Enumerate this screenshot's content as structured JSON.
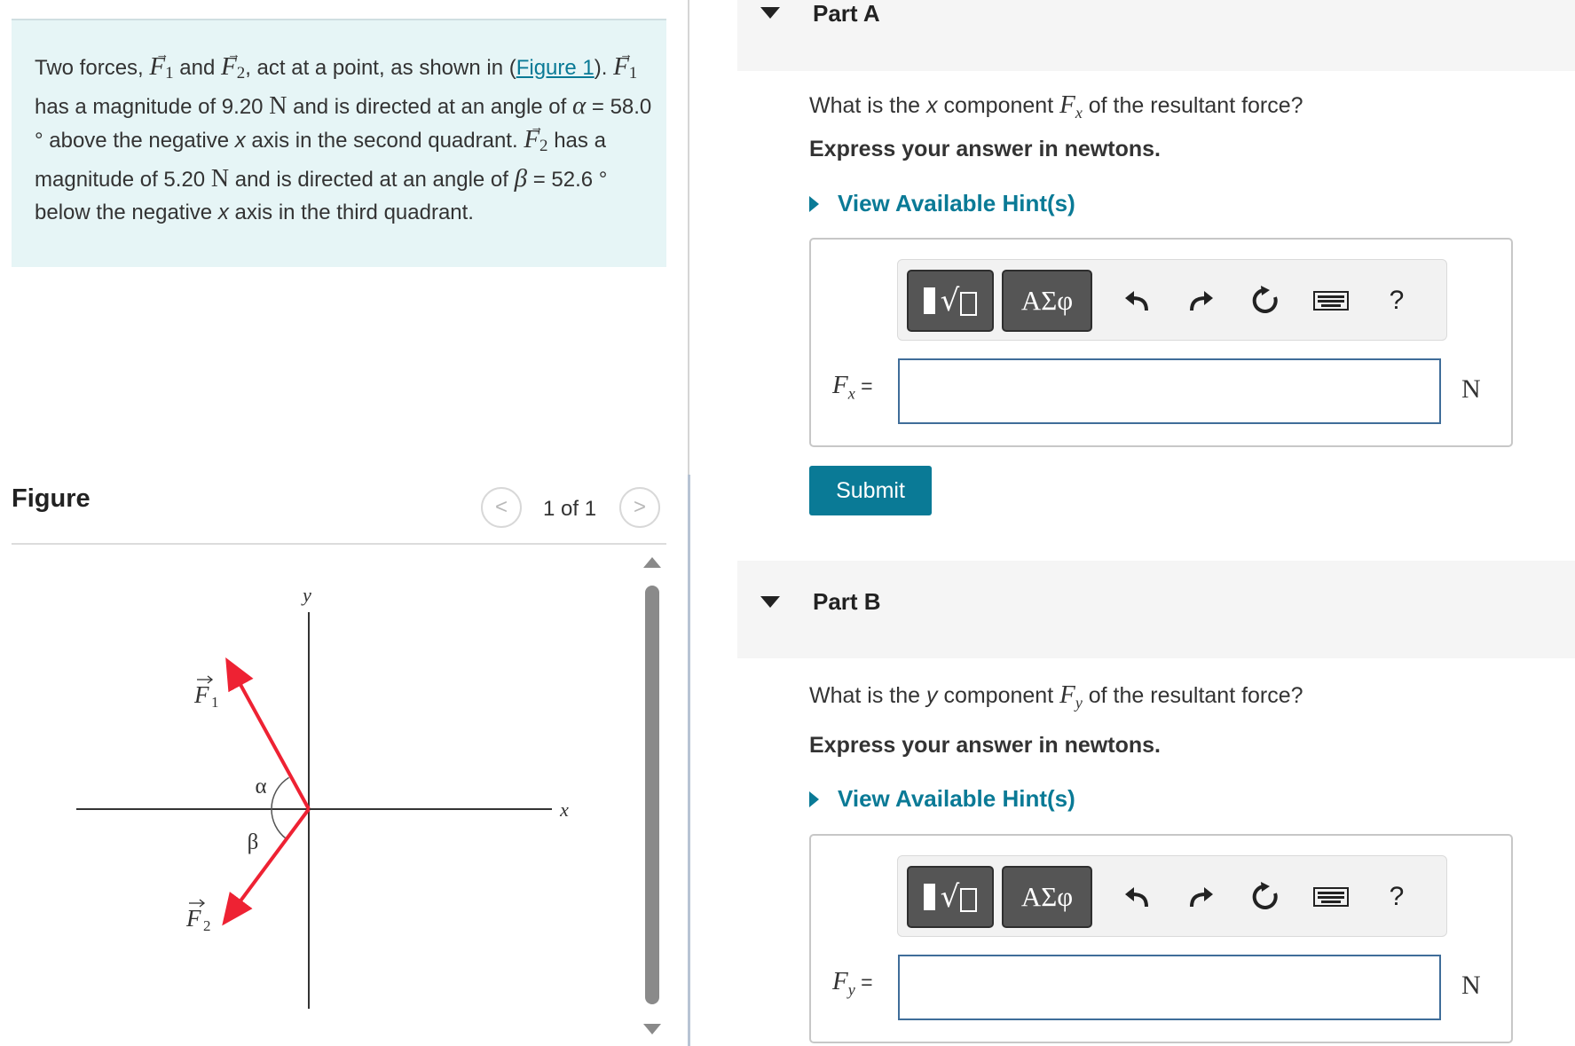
{
  "problem": {
    "t1": "Two forces, ",
    "f1": "F",
    "sub1": "1",
    "t2": " and ",
    "f2": "F",
    "sub2": "2",
    "t3": ", act at a point, as shown in (",
    "figure_link": "Figure 1",
    "t4": "). ",
    "f1b": "F",
    "sub1b": "1",
    "t5": " has a magnitude of 9.20 ",
    "unit1": "N",
    "t6": " and is directed at an angle of ",
    "alpha": "α",
    "t7": " = 58.0 ° above the negative ",
    "x1": "x",
    "t8": " axis in the second quadrant. ",
    "f2b": "F",
    "sub2b": "2",
    "t9": " has a magnitude of 5.20 ",
    "unit2": "N",
    "t10": " and is directed at an angle of ",
    "beta": "β",
    "t11": " = 52.6 ° below the negative ",
    "x2": "x",
    "t12": " axis in the third quadrant."
  },
  "figure_panel": {
    "title": "Figure",
    "counter": "1 of 1",
    "prev_glyph": "<",
    "next_glyph": ">",
    "diagram": {
      "y_label": "y",
      "x_label": "x",
      "f1_label": "F",
      "f1_sub": "1",
      "f2_label": "F",
      "f2_sub": "2",
      "alpha_label": "α",
      "beta_label": "β"
    }
  },
  "toolbar": {
    "templates_glyph": "√",
    "greek_label": "ΑΣφ",
    "help_label": "?"
  },
  "part_a": {
    "title": "Part A",
    "q1": "What is the ",
    "axis": "x",
    "q2": " component ",
    "var": "F",
    "var_sub": "x",
    "q3": " of the resultant force?",
    "instruction": "Express your answer in newtons.",
    "hint": "View Available Hint(s)",
    "label_var": "F",
    "label_sub": "x",
    "label_eq": " =",
    "input_value": "",
    "unit": "N",
    "submit": "Submit"
  },
  "part_b": {
    "title": "Part B",
    "q1": "What is the ",
    "axis": "y",
    "q2": " component ",
    "var": "F",
    "var_sub": "y",
    "q3": " of the resultant force?",
    "instruction": "Express your answer in newtons.",
    "hint": "View Available Hint(s)",
    "label_var": "F",
    "label_sub": "y",
    "label_eq": " =",
    "input_value": "",
    "unit": "N"
  },
  "colors": {
    "accent": "#0a7a96",
    "vector_red": "#ee2233",
    "problem_bg": "#e6f5f6"
  }
}
